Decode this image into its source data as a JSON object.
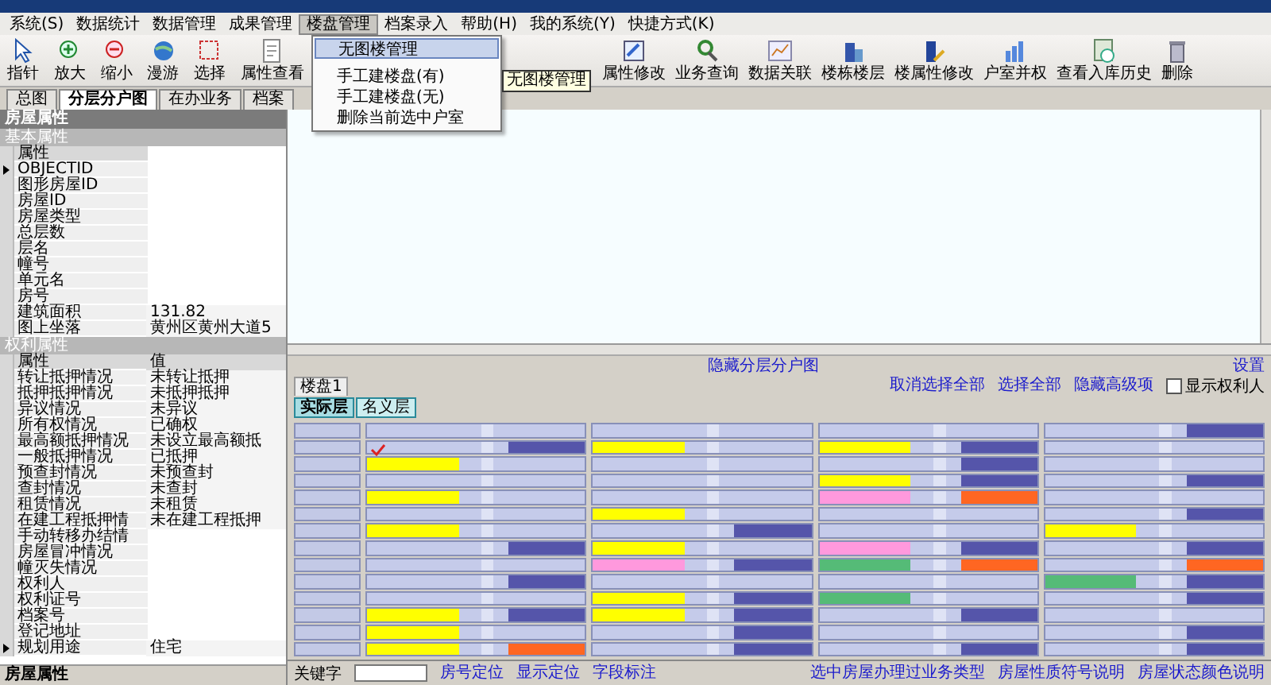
{
  "menu": [
    {
      "label": "系统(S)",
      "selected": false
    },
    {
      "label": "数据统计",
      "selected": false
    },
    {
      "label": "数据管理",
      "selected": false
    },
    {
      "label": "成果管理",
      "selected": false
    },
    {
      "label": "楼盘管理",
      "selected": true
    },
    {
      "label": "档案录入",
      "selected": false
    },
    {
      "label": "帮助(H)",
      "selected": false
    },
    {
      "label": "我的系统(Y)",
      "selected": false
    },
    {
      "label": "快捷方式(K)",
      "selected": false
    }
  ],
  "dropdown": [
    {
      "label": "无图楼管理",
      "selected": true
    },
    {
      "label": "手工建楼盘(有)",
      "selected": false
    },
    {
      "label": "手工建楼盘(无)",
      "selected": false
    },
    {
      "label": "删除当前选中户室",
      "selected": false
    }
  ],
  "tooltip": "无图楼管理",
  "toolbar_left": [
    "指针",
    "放大",
    "缩小",
    "漫游",
    "选择",
    "属性查看"
  ],
  "toolbar_right": [
    "属性修改",
    "业务查询",
    "数据关联",
    "楼栋楼层",
    "楼属性修改",
    "户室并权",
    "查看入库历史",
    "删除"
  ],
  "tabs": [
    {
      "label": "总图",
      "selected": false
    },
    {
      "label": "分层分户图",
      "selected": true
    },
    {
      "label": "在办业务",
      "selected": false
    },
    {
      "label": "档案",
      "selected": false
    }
  ],
  "panel_title": "房屋属性",
  "basic": {
    "title": "基本属性",
    "header": "属性",
    "rows": [
      {
        "name": "OBJECTID",
        "value": "",
        "current": true
      },
      {
        "name": "图形房屋ID",
        "value": "",
        "current": false
      },
      {
        "name": "房屋ID",
        "value": "",
        "current": false
      },
      {
        "name": "房屋类型",
        "value": "",
        "current": false
      },
      {
        "name": "总层数",
        "value": "",
        "current": false
      },
      {
        "name": "层名",
        "value": "",
        "current": false
      },
      {
        "name": "幢号",
        "value": "",
        "current": false
      },
      {
        "name": "单元名",
        "value": "",
        "current": false
      },
      {
        "name": "房号",
        "value": "",
        "current": false
      },
      {
        "name": "建筑面积",
        "value": "131.82",
        "current": false
      },
      {
        "name": "图上坐落",
        "value": "黄州区黄州大道5",
        "current": false
      }
    ]
  },
  "rights": {
    "title": "权利属性",
    "headers": [
      "属性",
      "值"
    ],
    "rows": [
      {
        "name": "转让抵押情况",
        "value": "未转让抵押",
        "current": false
      },
      {
        "name": "抵押抵押情况",
        "value": "未抵押抵押",
        "current": false
      },
      {
        "name": "异议情况",
        "value": "未异议",
        "current": false
      },
      {
        "name": "所有权情况",
        "value": "已确权",
        "current": false
      },
      {
        "name": "最高额抵押情况",
        "value": "未设立最高额抵",
        "current": false
      },
      {
        "name": "一般抵押情况",
        "value": "已抵押",
        "current": false
      },
      {
        "name": "预查封情况",
        "value": "未预查封",
        "current": false
      },
      {
        "name": "查封情况",
        "value": "未查封",
        "current": false
      },
      {
        "name": "租赁情况",
        "value": "未租赁",
        "current": false
      },
      {
        "name": "在建工程抵押情",
        "value": "未在建工程抵押",
        "current": false
      },
      {
        "name": "手动转移办结情",
        "value": "",
        "current": false
      },
      {
        "name": "房屋冒冲情况",
        "value": "",
        "current": false
      },
      {
        "name": "幢灭失情况",
        "value": "",
        "current": false
      },
      {
        "name": "权利人",
        "value": "",
        "current": false
      },
      {
        "name": "权利证号",
        "value": "",
        "current": false
      },
      {
        "name": "档案号",
        "value": "",
        "current": false
      },
      {
        "name": "登记地址",
        "value": "",
        "current": false
      },
      {
        "name": "规划用途",
        "value": "住宅",
        "current": true
      }
    ]
  },
  "panel_footer": "房屋属性",
  "hide_link": "隐藏分层分户图",
  "settings_link": "设置",
  "building_tab": "楼盘1",
  "floor_buttons": [
    {
      "label": "实际层",
      "selected": true
    },
    {
      "label": "名义层",
      "selected": false
    }
  ],
  "actions": [
    "取消选择全部",
    "选择全部",
    "隐藏高级项"
  ],
  "show_owner": {
    "label": "显示权利人",
    "checked": false
  },
  "grid": [
    [
      {
        "ticked": false
      },
      {
        "ticked": false
      },
      {
        "ticked": false
      },
      {
        "ticked": false,
        "right": {
          "color": "#5555aa"
        }
      }
    ],
    [
      {
        "ticked": true,
        "right": {
          "color": "#5555aa"
        }
      },
      {
        "ticked": false,
        "left": {
          "color": "#ffff00"
        }
      },
      {
        "ticked": false,
        "left": {
          "color": "#ffff00"
        },
        "right": {
          "color": "#5555aa"
        }
      },
      {
        "ticked": false
      }
    ],
    [
      {
        "ticked": false,
        "left": {
          "color": "#ffff00"
        }
      },
      {
        "ticked": false
      },
      {
        "ticked": false,
        "right": {
          "color": "#5555aa"
        }
      },
      {
        "ticked": false
      }
    ],
    [
      {
        "ticked": false
      },
      {
        "ticked": false
      },
      {
        "ticked": false,
        "left": {
          "color": "#ffff00"
        },
        "right": {
          "color": "#5555aa"
        }
      },
      {
        "ticked": false,
        "right": {
          "color": "#5555aa"
        }
      }
    ],
    [
      {
        "ticked": false,
        "left": {
          "color": "#ffff00"
        }
      },
      {
        "ticked": false
      },
      {
        "ticked": false,
        "left": {
          "color": "#ff99dd"
        },
        "right": {
          "color": "#ff6622"
        }
      },
      {
        "ticked": false
      }
    ],
    [
      {
        "ticked": false
      },
      {
        "ticked": false,
        "left": {
          "color": "#ffff00"
        }
      },
      {
        "ticked": false
      },
      {
        "ticked": false,
        "right": {
          "color": "#5555aa"
        }
      }
    ],
    [
      {
        "ticked": false,
        "left": {
          "color": "#ffff00"
        }
      },
      {
        "ticked": false,
        "right": {
          "color": "#5555aa"
        }
      },
      {
        "ticked": false
      },
      {
        "ticked": false,
        "left": {
          "color": "#ffff00"
        }
      }
    ],
    [
      {
        "ticked": false,
        "right": {
          "color": "#5555aa"
        }
      },
      {
        "ticked": false,
        "left": {
          "color": "#ffff00"
        }
      },
      {
        "ticked": false,
        "left": {
          "color": "#ff99dd"
        },
        "right": {
          "color": "#5555aa"
        }
      },
      {
        "ticked": false,
        "right": {
          "color": "#5555aa"
        }
      }
    ],
    [
      {
        "ticked": false
      },
      {
        "ticked": false,
        "left": {
          "color": "#ff99dd"
        },
        "right": {
          "color": "#5555aa"
        }
      },
      {
        "ticked": false,
        "left": {
          "color": "#55bb77"
        },
        "right": {
          "color": "#ff6622"
        }
      },
      {
        "ticked": false,
        "right": {
          "color": "#ff6622"
        }
      }
    ],
    [
      {
        "ticked": false,
        "right": {
          "color": "#5555aa"
        }
      },
      {
        "ticked": false
      },
      {
        "ticked": false
      },
      {
        "ticked": false,
        "left": {
          "color": "#55bb77"
        },
        "right": {
          "color": "#5555aa"
        }
      }
    ],
    [
      {
        "ticked": false
      },
      {
        "ticked": false,
        "left": {
          "color": "#ffff00"
        },
        "right": {
          "color": "#5555aa"
        }
      },
      {
        "ticked": false,
        "left": {
          "color": "#55bb77"
        }
      },
      {
        "ticked": false,
        "right": {
          "color": "#5555aa"
        }
      }
    ],
    [
      {
        "ticked": false,
        "left": {
          "color": "#ffff00"
        },
        "right": {
          "color": "#5555aa"
        }
      },
      {
        "ticked": false,
        "left": {
          "color": "#ffff00"
        },
        "right": {
          "color": "#5555aa"
        }
      },
      {
        "ticked": false,
        "right": {
          "color": "#5555aa"
        }
      },
      {
        "ticked": false
      }
    ],
    [
      {
        "ticked": false,
        "left": {
          "color": "#ffff00"
        }
      },
      {
        "ticked": false,
        "right": {
          "color": "#5555aa"
        }
      },
      {
        "ticked": false
      },
      {
        "ticked": false,
        "right": {
          "color": "#5555aa"
        }
      }
    ],
    [
      {
        "ticked": false,
        "left": {
          "color": "#ffff00"
        },
        "right": {
          "color": "#ff6622"
        }
      },
      {
        "ticked": false,
        "right": {
          "color": "#5555aa"
        }
      },
      {
        "ticked": false,
        "right": {
          "color": "#5555aa"
        }
      },
      {
        "ticked": false,
        "right": {
          "color": "#5555aa"
        }
      }
    ]
  ],
  "bottom": {
    "keyword_label": "关键字",
    "links_left": [
      "房号定位",
      "显示定位",
      "字段标注"
    ],
    "links_right": [
      "选中房屋办理过业务类型",
      "房屋性质符号说明",
      "房屋状态颜色说明"
    ]
  }
}
